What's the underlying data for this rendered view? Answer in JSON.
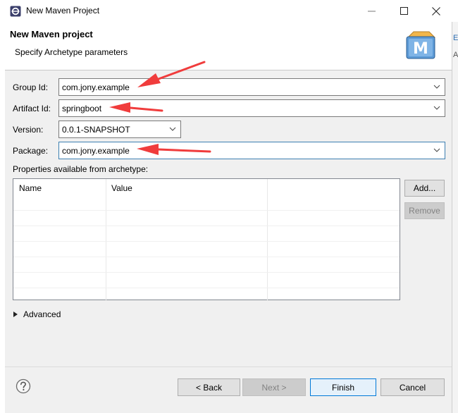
{
  "window": {
    "title": "New Maven Project"
  },
  "header": {
    "title": "New Maven project",
    "subtitle": "Specify Archetype parameters",
    "logo_letter": "M"
  },
  "background_window": {
    "glyph_1": "E",
    "glyph_2": "A"
  },
  "form": {
    "group_id": {
      "label": "Group Id:",
      "value": "com.jony.example"
    },
    "artifact_id": {
      "label": "Artifact Id:",
      "value": "springboot"
    },
    "version": {
      "label": "Version:",
      "value": "0.0.1-SNAPSHOT"
    },
    "package": {
      "label": "Package:",
      "value": "com.jony.example"
    }
  },
  "properties": {
    "label": "Properties available from archetype:",
    "columns": [
      "Name",
      "Value"
    ],
    "add_label": "Add...",
    "remove_label": "Remove"
  },
  "advanced": {
    "label": "Advanced"
  },
  "footer": {
    "back_label": "< Back",
    "next_label": "Next >",
    "finish_label": "Finish",
    "cancel_label": "Cancel"
  },
  "colors": {
    "annotation_arrow": "#f03c3c",
    "focus_border": "#3c7fb1",
    "primary_border": "#0078d7"
  }
}
